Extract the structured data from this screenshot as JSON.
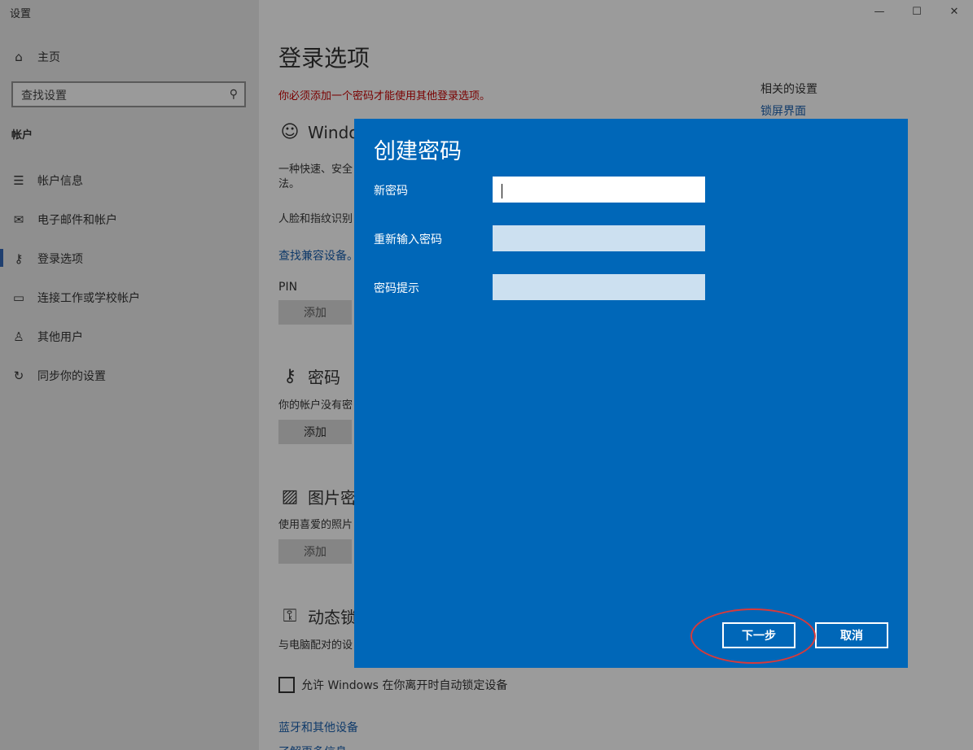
{
  "window": {
    "title": "设置",
    "controls": [
      "—",
      "☐",
      "✕"
    ]
  },
  "sidebar": {
    "home": "主页",
    "search_placeholder": "查找设置",
    "section": "帐户",
    "items": [
      {
        "label": "帐户信息",
        "icon": "account-info-icon"
      },
      {
        "label": "电子邮件和帐户",
        "icon": "mail-icon"
      },
      {
        "label": "登录选项",
        "icon": "key-icon"
      },
      {
        "label": "连接工作或学校帐户",
        "icon": "briefcase-icon"
      },
      {
        "label": "其他用户",
        "icon": "person-add-icon"
      },
      {
        "label": "同步你的设置",
        "icon": "sync-icon"
      }
    ]
  },
  "main": {
    "title": "登录选项",
    "warning": "你必须添加一个密码才能使用其他登录选项。",
    "related_title": "相关的设置",
    "related_link": "锁屏界面",
    "windows_hello_head": "Windo",
    "hello_desc_line1": "一种快速、安全",
    "hello_desc_line2": "法。",
    "hello_face": "人脸和指纹识别",
    "find_devices": "查找兼容设备。",
    "pin_label": "PIN",
    "add_label": "添加",
    "password_head": "密码",
    "password_desc": "你的帐户没有密",
    "picture_head": "图片密",
    "picture_desc": "使用喜爱的照片",
    "dynamic_head": "动态锁",
    "dynamic_desc": "与电脑配对的设",
    "checkbox_label": "允许 Windows 在你离开时自动锁定设备",
    "bluetooth_link": "蓝牙和其他设备",
    "more_link": "了解更多信息"
  },
  "dialog": {
    "title": "创建密码",
    "new_password_label": "新密码",
    "new_password_value": "",
    "reenter_label": "重新输入密码",
    "reenter_value": "",
    "hint_label": "密码提示",
    "hint_value": "",
    "next_button": "下一步",
    "cancel_button": "取消"
  },
  "colors": {
    "dialog_bg": "#0067b8",
    "highlight_ring": "#d83a3a",
    "warning_text": "#7a0000"
  }
}
